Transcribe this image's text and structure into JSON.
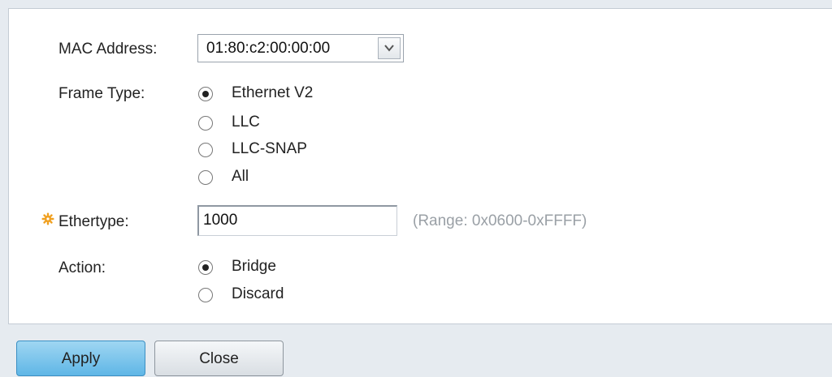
{
  "form": {
    "mac_address": {
      "label": "MAC Address:",
      "value": "01:80:c2:00:00:00"
    },
    "frame_type": {
      "label": "Frame Type:",
      "options": [
        "Ethernet V2",
        "LLC",
        "LLC-SNAP",
        "All"
      ],
      "selected": "Ethernet V2"
    },
    "ethertype": {
      "label": "Ethertype:",
      "value": "1000",
      "hint": "(Range: 0x0600-0xFFFF)",
      "required_icon": "gear-asterisk-icon"
    },
    "action": {
      "label": "Action:",
      "options": [
        "Bridge",
        "Discard"
      ],
      "selected": "Bridge"
    }
  },
  "buttons": {
    "apply": "Apply",
    "close": "Close"
  },
  "colors": {
    "required_icon": "#f0a020",
    "apply_button": "#5fb6e6",
    "hint_text": "#9aa0a6"
  }
}
